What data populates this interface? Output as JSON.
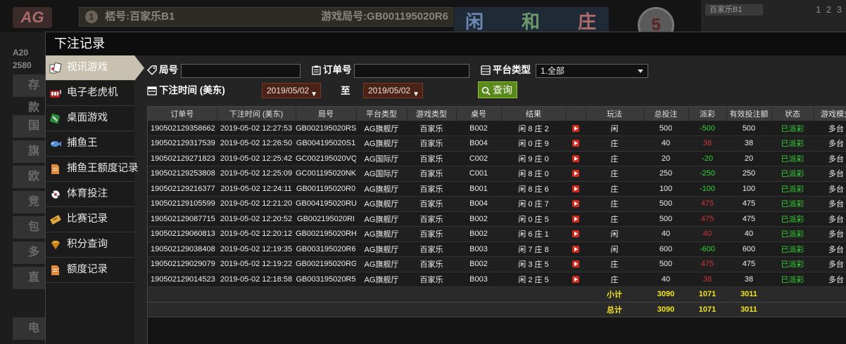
{
  "background": {
    "logo": "AG",
    "table_name": "桮号:百家乐B1",
    "table_num": "1",
    "round_id": "游戏局号:GB001195020R6",
    "road_labels": [
      "闲",
      "和",
      "庄"
    ],
    "timer": "5",
    "right_tab": "百家乐B1",
    "right_digits": "1 2 3",
    "account_lines": [
      "A20",
      "2580"
    ],
    "side_menu": [
      "存款",
      "国际",
      "旗舰",
      "欧洲",
      "竞",
      "包",
      "多",
      "直",
      "电子"
    ]
  },
  "modal": {
    "title": "下注记录",
    "sidebar": [
      {
        "label": "视讯游戏",
        "icon": "cards-icon",
        "active": true
      },
      {
        "label": "电子老虎机",
        "icon": "slot-icon",
        "active": false
      },
      {
        "label": "桌面游戏",
        "icon": "dice-icon",
        "active": false
      },
      {
        "label": "捕鱼王",
        "icon": "fish-icon",
        "active": false
      },
      {
        "label": "捕鱼王额度记录",
        "icon": "document-icon",
        "active": false
      },
      {
        "label": "体育投注",
        "icon": "ball-icon",
        "active": false
      },
      {
        "label": "比赛记录",
        "icon": "ticket-icon",
        "active": false
      },
      {
        "label": "积分查询",
        "icon": "diamond-icon",
        "active": false
      },
      {
        "label": "额度记录",
        "icon": "document-icon",
        "active": false
      }
    ],
    "filters": {
      "round_label": "局号",
      "round_value": "",
      "order_label": "订单号",
      "order_value": "",
      "platform_label": "平台类型",
      "platform_value": "1.全部",
      "time_label": "下注时间 (美东)",
      "date_from": "2019/05/02",
      "to_label": "至",
      "date_to": "2019/05/02",
      "query_label": "查询"
    },
    "table": {
      "headers": [
        "订单号",
        "下注时间 (美东)",
        "局号",
        "平台类型",
        "游戏类型",
        "桌号",
        "结果",
        "",
        "玩法",
        "总投注",
        "派彩",
        "有效投注额",
        "状态",
        "游戏模式"
      ],
      "rows": [
        [
          "190502129358662",
          "2019-05-02 12:27:53",
          "GB002195020RS",
          "AG旗舰厅",
          "百家乐",
          "B002",
          "闲 8 庄 2",
          "闲",
          "500",
          "-500",
          "500",
          "已派彩",
          "多台"
        ],
        [
          "190502129317539",
          "2019-05-02 12:26:50",
          "GB004195020S1",
          "AG旗舰厅",
          "百家乐",
          "B004",
          "闲 0 庄 9",
          "庄",
          "40",
          "38",
          "38",
          "已派彩",
          "多台"
        ],
        [
          "190502129271823",
          "2019-05-02 12:25:42",
          "GC002195020VQ",
          "AG国际厅",
          "百家乐",
          "C002",
          "闲 9 庄 0",
          "庄",
          "20",
          "-20",
          "20",
          "已派彩",
          "多台"
        ],
        [
          "190502129253808",
          "2019-05-02 12:25:09",
          "GC001195020NK",
          "AG国际厅",
          "百家乐",
          "C001",
          "闲 8 庄 0",
          "庄",
          "250",
          "-250",
          "250",
          "已派彩",
          "多台"
        ],
        [
          "190502129216377",
          "2019-05-02 12:24:11",
          "GB001195020R0",
          "AG旗舰厅",
          "百家乐",
          "B001",
          "闲 8 庄 6",
          "庄",
          "100",
          "-100",
          "100",
          "已派彩",
          "多台"
        ],
        [
          "190502129105599",
          "2019-05-02 12:21:20",
          "GB004195020RU",
          "AG旗舰厅",
          "百家乐",
          "B004",
          "闲 0 庄 7",
          "庄",
          "500",
          "475",
          "475",
          "已派彩",
          "多台"
        ],
        [
          "190502129087715",
          "2019-05-02 12:20:52",
          "GB002195020RI",
          "AG旗舰厅",
          "百家乐",
          "B002",
          "闲 0 庄 5",
          "庄",
          "500",
          "475",
          "475",
          "已派彩",
          "多台"
        ],
        [
          "190502129060813",
          "2019-05-02 12:20:12",
          "GB002195020RH",
          "AG旗舰厅",
          "百家乐",
          "B002",
          "闲 6 庄 1",
          "闲",
          "40",
          "40",
          "40",
          "已派彩",
          "多台"
        ],
        [
          "190502129038408",
          "2019-05-02 12:19:35",
          "GB003195020R6",
          "AG旗舰厅",
          "百家乐",
          "B003",
          "闲 7 庄 8",
          "闲",
          "600",
          "-600",
          "600",
          "已派彩",
          "多台"
        ],
        [
          "190502129029079",
          "2019-05-02 12:19:22",
          "GB002195020RG",
          "AG旗舰厅",
          "百家乐",
          "B002",
          "闲 3 庄 5",
          "庄",
          "500",
          "475",
          "475",
          "已派彩",
          "多台"
        ],
        [
          "190502129014523",
          "2019-05-02 12:18:58",
          "GB003195020R5",
          "AG旗舰厅",
          "百家乐",
          "B003",
          "闲 2 庄 5",
          "庄",
          "40",
          "38",
          "38",
          "已派彩",
          "多台"
        ]
      ],
      "subtotal": {
        "label": "小计",
        "bet": "3090",
        "payout": "1071",
        "valid": "3011"
      },
      "total": {
        "label": "总计",
        "bet": "3090",
        "payout": "1071",
        "valid": "3011"
      }
    }
  },
  "colors": {
    "positive": "#35d235",
    "negative": "#d03434",
    "summary": "#f5e51d",
    "active_tab": "#c9c1b0",
    "date_bg": "#4a2216",
    "query_btn": "#5b8a1c"
  }
}
